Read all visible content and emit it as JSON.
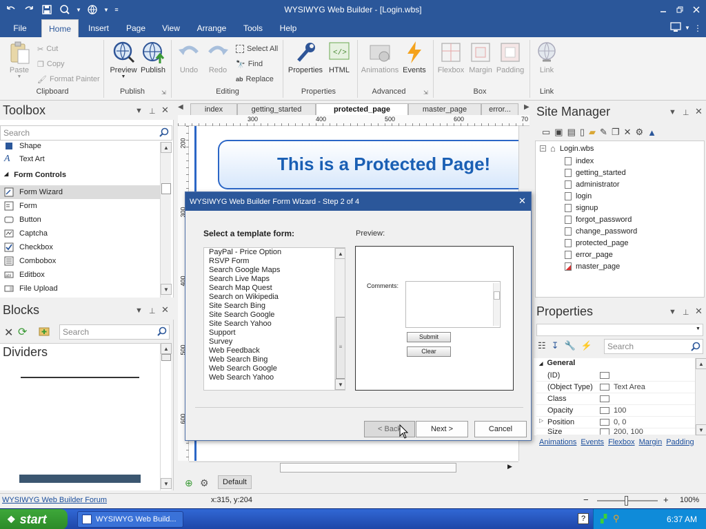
{
  "window": {
    "title": "WYSIWYG Web Builder - [Login.wbs]"
  },
  "menu": {
    "tabs": [
      "File",
      "Home",
      "Insert",
      "Page",
      "View",
      "Arrange",
      "Tools",
      "Help"
    ],
    "active": "Home"
  },
  "ribbon": {
    "clipboard": {
      "paste": "Paste",
      "cut": "Cut",
      "copy": "Copy",
      "format_painter": "Format Painter",
      "label": "Clipboard"
    },
    "publish": {
      "preview": "Preview",
      "publish": "Publish",
      "label": "Publish"
    },
    "editing": {
      "undo": "Undo",
      "redo": "Redo",
      "select_all": "Select All",
      "find": "Find",
      "replace": "Replace",
      "label": "Editing"
    },
    "properties": {
      "properties": "Properties",
      "html": "HTML",
      "label": "Properties"
    },
    "advanced": {
      "animations": "Animations",
      "events": "Events",
      "label": "Advanced"
    },
    "box": {
      "flexbox": "Flexbox",
      "margin": "Margin",
      "padding": "Padding",
      "label": "Box"
    },
    "link": {
      "link": "Link",
      "label": "Link"
    }
  },
  "toolbox": {
    "title": "Toolbox",
    "search_placeholder": "Search",
    "items": [
      {
        "label": "Shape",
        "icon": "shape-icon"
      },
      {
        "label": "Text Art",
        "icon": "text-art-icon"
      }
    ],
    "section": "Form Controls",
    "form_items": [
      {
        "label": "Form Wizard",
        "icon": "form-wizard-icon"
      },
      {
        "label": "Form",
        "icon": "form-icon"
      },
      {
        "label": "Button",
        "icon": "button-icon"
      },
      {
        "label": "Captcha",
        "icon": "captcha-icon"
      },
      {
        "label": "Checkbox",
        "icon": "checkbox-icon"
      },
      {
        "label": "Combobox",
        "icon": "combobox-icon"
      },
      {
        "label": "Editbox",
        "icon": "editbox-icon"
      },
      {
        "label": "File Upload",
        "icon": "file-upload-icon"
      }
    ]
  },
  "blocks": {
    "title": "Blocks",
    "search_placeholder": "Search",
    "category": "Dividers"
  },
  "doc_tabs": [
    "index",
    "getting_started",
    "protected_page",
    "master_page",
    "error..."
  ],
  "doc_tabs_active": "protected_page",
  "ruler": {
    "h": [
      "300",
      "400",
      "500",
      "600",
      "70"
    ],
    "v": [
      "200",
      "300",
      "400",
      "500",
      "600"
    ]
  },
  "page": {
    "heading": "This is a Protected Page!"
  },
  "canvas_footer": {
    "default_label": "Default"
  },
  "site_manager": {
    "title": "Site Manager",
    "root": "Login.wbs",
    "pages": [
      "index",
      "getting_started",
      "administrator",
      "login",
      "signup",
      "forgot_password",
      "change_password",
      "protected_page",
      "error_page",
      "master_page"
    ]
  },
  "properties": {
    "title": "Properties",
    "search_placeholder": "Search",
    "group": "General",
    "rows": [
      {
        "key": "(ID)",
        "value": ""
      },
      {
        "key": "(Object Type)",
        "value": "Text Area"
      },
      {
        "key": "Class",
        "value": ""
      },
      {
        "key": "Opacity",
        "value": "100"
      },
      {
        "key": "Position",
        "value": "0, 0"
      },
      {
        "key": "Size",
        "value": "200, 100"
      }
    ],
    "links": [
      "Animations",
      "Events",
      "Flexbox",
      "Margin",
      "Padding"
    ]
  },
  "dialog": {
    "title": "WYSIWYG Web Builder Form Wizard - Step 2 of 4",
    "select_label": "Select a template form:",
    "preview_label": "Preview:",
    "templates": [
      "PayPal - Price Option",
      "RSVP Form",
      "Search Google Maps",
      "Search Live Maps",
      "Search Map Quest",
      "Search on Wikipedia",
      "Site Search Bing",
      "Site Search Google",
      "Site Search Yahoo",
      "Support",
      "Survey",
      "Web Feedback",
      "Web Search Bing",
      "Web Search Google",
      "Web Search Yahoo"
    ],
    "preview_form": {
      "comments_label": "Comments:",
      "submit": "Submit",
      "clear": "Clear"
    },
    "buttons": {
      "back": "< Back",
      "next": "Next >",
      "cancel": "Cancel"
    }
  },
  "status": {
    "forum_link": "WYSIWYG Web Builder Forum",
    "coords": "x:315, y:204",
    "zoom": "100%"
  },
  "taskbar": {
    "start": "start",
    "task": "WYSIWYG Web Build...",
    "clock": "6:37 AM"
  },
  "colors": {
    "accent": "#2b579a",
    "heading": "#1a5fb4",
    "taskbar": "#245edb",
    "start": "#3a9a35"
  }
}
